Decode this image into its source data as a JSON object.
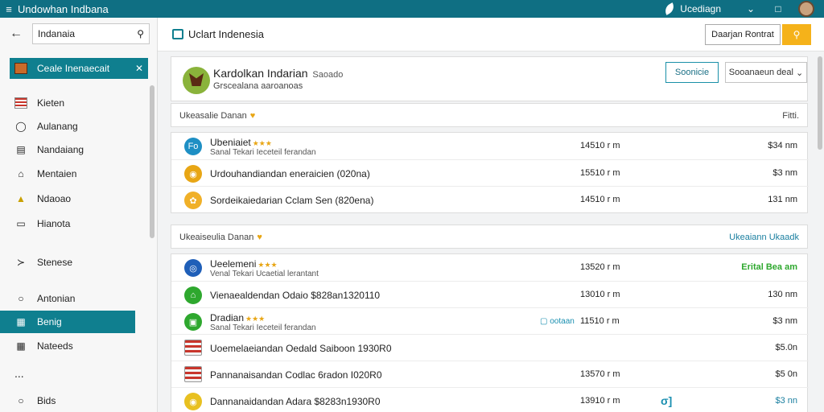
{
  "window": {
    "title": "Undowhan Indbana",
    "account": "Ucediagn"
  },
  "sidebar": {
    "search_value": "Indanaia",
    "chip_label": "Ceale Inenaecait",
    "items": [
      {
        "label": "Kieten",
        "icon": "flag-icon"
      },
      {
        "label": "Aulanang",
        "icon": "pin-icon"
      },
      {
        "label": "Nandaiang",
        "icon": "list-icon"
      },
      {
        "label": "Mentaien",
        "icon": "home-icon"
      },
      {
        "label": "Ndaoao",
        "icon": "warning-icon"
      },
      {
        "label": "Hianota",
        "icon": "document-icon"
      },
      {
        "label": "Stenese",
        "icon": "tag-icon"
      },
      {
        "label": "Antonian",
        "icon": "user-icon"
      },
      {
        "label": "Benig",
        "icon": "calendar-icon"
      },
      {
        "label": "Nateeds",
        "icon": "grid-icon"
      },
      {
        "label": "...",
        "icon": "more-icon"
      },
      {
        "label": "Bids",
        "icon": "gavel-icon"
      }
    ]
  },
  "topbar": {
    "title": "Uclart Indenesia",
    "button_label": "Daarjan Rontrat"
  },
  "profile": {
    "name": "Kardolkan Indarian",
    "name_small": "Saoado",
    "subtitle": "Grscealana aaroanoas",
    "button_label": "Soonicie",
    "select_label": "Sooanaeun deal"
  },
  "section1": {
    "title": "Ukeasalie Danan",
    "right_label": "Fitti."
  },
  "section2": {
    "title": "Ukeaiseulia Danan",
    "right_label": "Ukeaiann Ukaadk"
  },
  "list1": [
    {
      "name": "Ubeniaiet",
      "stars": "★★★",
      "sub": "Sanal Tekari Ieceteil ferandan",
      "size": "14510 r m",
      "price": "$34 nm",
      "icon_color": "#1e8fc4",
      "icon_glyph": "Fo"
    },
    {
      "name": "Urdouhandiandan eneraicien (020na)",
      "size": "15510 r m",
      "price": "$3 nm",
      "icon_color": "#e8a615",
      "icon_glyph": "◉"
    },
    {
      "name": "Sordeikaiedarian Cclam Sen (820ena)",
      "size": "14510 r m",
      "price": "131 nm",
      "icon_color": "#f0b028",
      "icon_glyph": "✿"
    }
  ],
  "list2": [
    {
      "name": "Ueelemeni",
      "stars": "★★★",
      "sub": "Venal Tekari Ucaetial lerantant",
      "size": "13520 r m",
      "price": "Erital Bea am",
      "price_style": "green",
      "icon_color": "#1f5fb8",
      "icon_glyph": "◎"
    },
    {
      "name": "Vienaealdendan Odaio $828an1320110",
      "size": "13010 r m",
      "price": "130 nm",
      "icon_color": "#2ea82e",
      "icon_glyph": "⌂"
    },
    {
      "name": "Dradian",
      "stars": "★★★",
      "sub": "Sanal Tekari Ieceteil ferandan",
      "size": "11510 r m",
      "price": "$3 nm",
      "tag": "▢ ootaan",
      "icon_color": "#2ea82e",
      "icon_glyph": "▣"
    },
    {
      "name": "Uoemelaeiandan Oedald Saiboon 1930R0",
      "size": "",
      "price": "$5.0n",
      "flag": true
    },
    {
      "name": "Pannanaisandan Codlac 6radon I020R0",
      "size": "13570 r m",
      "price": "$5 0n",
      "flag": true
    },
    {
      "name": "Dannanaidandan Adara $8283n1930R0",
      "size": "13910 r m",
      "price": "$3 nn",
      "price_style": "blue",
      "swirl": "σ]",
      "icon_color": "#e8c020",
      "icon_glyph": "◉"
    }
  ]
}
